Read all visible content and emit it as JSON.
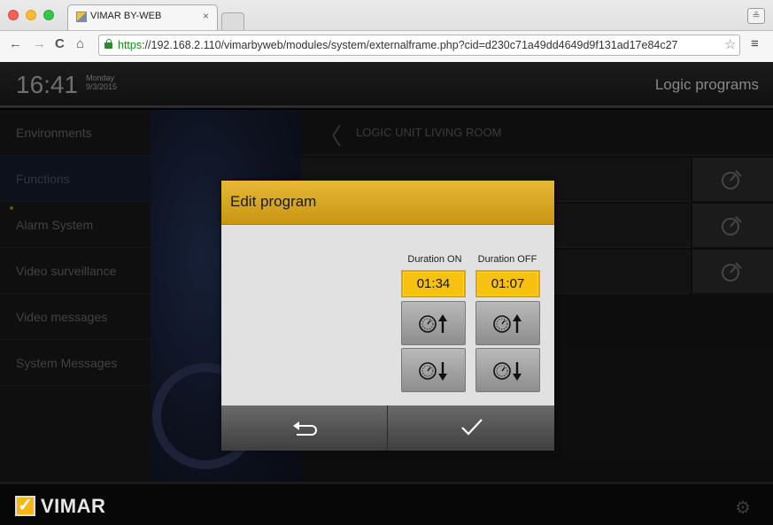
{
  "browser": {
    "tab_title": "VIMAR BY-WEB",
    "tab_close": "×",
    "url_scheme": "https",
    "url_rest": "://192.168.2.110/vimarbyweb/modules/system/externalframe.php?cid=d230c71a49dd4649d9f131ad17e84c27",
    "back_glyph": "←",
    "forward_glyph": "→",
    "reload_glyph": "C",
    "home_glyph": "⌂",
    "star_glyph": "☆",
    "menu_glyph": "≡",
    "profile_glyph": "≗"
  },
  "header": {
    "time": "16:41",
    "day": "Monday",
    "date": "9/3/2015",
    "page_title": "Logic programs"
  },
  "sidebar": {
    "items": [
      {
        "label": "Environments"
      },
      {
        "label": "Functions"
      },
      {
        "label": "Alarm System"
      },
      {
        "label": "Video surveillance"
      },
      {
        "label": "Video messages"
      },
      {
        "label": "System Messages"
      }
    ]
  },
  "list": {
    "back_glyph": "〈",
    "title": "LOGIC UNIT LIVING ROOM"
  },
  "dialog": {
    "title": "Edit program",
    "on_label": "Duration ON",
    "off_label": "Duration OFF",
    "on_value": "01:34",
    "off_value": "01:07"
  },
  "footer": {
    "brand": "VIMAR",
    "logo_check": "✓",
    "settings_glyph": "⚙"
  },
  "colors": {
    "accent": "#f3b913",
    "dialog_header": "#d9a828",
    "active_sidebar": "#141b2a"
  }
}
